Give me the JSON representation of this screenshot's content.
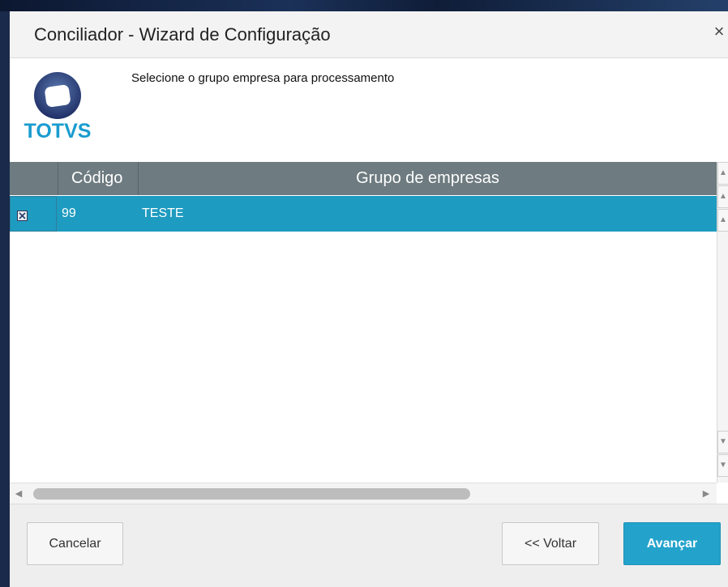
{
  "dialog": {
    "title": "Conciliador - Wizard de Configuração",
    "close_label": "×"
  },
  "header": {
    "logo_text": "TOTVS",
    "instruction": "Selecione o grupo empresa para processamento"
  },
  "grid": {
    "columns": [
      "",
      "Código",
      "Grupo de empresas"
    ],
    "rows": [
      {
        "selected": true,
        "codigo": "99",
        "grupo": "TESTE"
      }
    ]
  },
  "footer": {
    "cancel_label": "Cancelar",
    "back_label": "<< Voltar",
    "next_label": "Avançar"
  },
  "colors": {
    "header_bg": "#6e7b80",
    "selected_row": "#1e9bc0",
    "primary_button": "#23a3cc",
    "logo_text": "#1a9ccf"
  }
}
